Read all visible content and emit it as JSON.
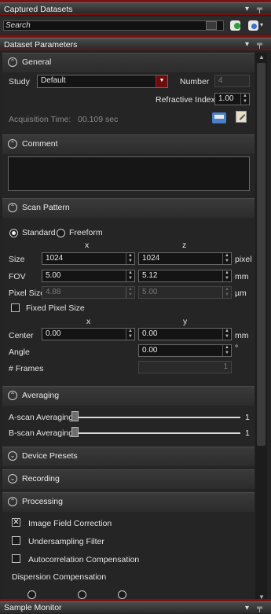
{
  "captured": {
    "title": "Captured Datasets",
    "search_placeholder": "Search",
    "pin_icon": "pin-icon",
    "dropdown_icon": "chevron-down-icon"
  },
  "params": {
    "title": "Dataset Parameters",
    "general": {
      "title": "General",
      "study_label": "Study",
      "study_value": "Default",
      "number_label": "Number",
      "number_value": "4",
      "ri_label": "Refractive Index",
      "ri_value": "1.00",
      "acq_label": "Acquisition Time:",
      "acq_value": "00.109 sec"
    },
    "comment": {
      "title": "Comment"
    },
    "scan": {
      "title": "Scan Pattern",
      "standard_label": "Standard",
      "freeform_label": "Freeform",
      "col_x": "x",
      "col_z": "z",
      "size_label": "Size",
      "size_x": "1024",
      "size_z": "1024",
      "size_unit": "pixel",
      "fov_label": "FOV",
      "fov_x": "5.00",
      "fov_z": "5.12",
      "fov_unit": "mm",
      "pix_label": "Pixel Size",
      "pix_x": "4.88",
      "pix_z": "5.00",
      "pix_unit": "µm",
      "fixed_label": "Fixed Pixel Size",
      "col_x2": "x",
      "col_y": "y",
      "center_label": "Center",
      "center_x": "0.00",
      "center_y": "0.00",
      "center_unit": "mm",
      "angle_label": "Angle",
      "angle_value": "0.00",
      "angle_unit": "°",
      "frames_label": "# Frames",
      "frames_value": "1"
    },
    "averaging": {
      "title": "Averaging",
      "ascan_label": "A-scan Averaging",
      "ascan_value": "1",
      "bscan_label": "B-scan Averaging",
      "bscan_value": "1"
    },
    "device_presets": {
      "title": "Device Presets"
    },
    "recording": {
      "title": "Recording"
    },
    "processing": {
      "title": "Processing",
      "ifc_label": "Image Field Correction",
      "usf_label": "Undersampling Filter",
      "acc_label": "Autocorrelation Compensation",
      "disp_label": "Dispersion Compensation"
    }
  },
  "sample_monitor": {
    "title": "Sample Monitor"
  },
  "colors": {
    "accent": "#7a1010",
    "background": "#232323"
  }
}
